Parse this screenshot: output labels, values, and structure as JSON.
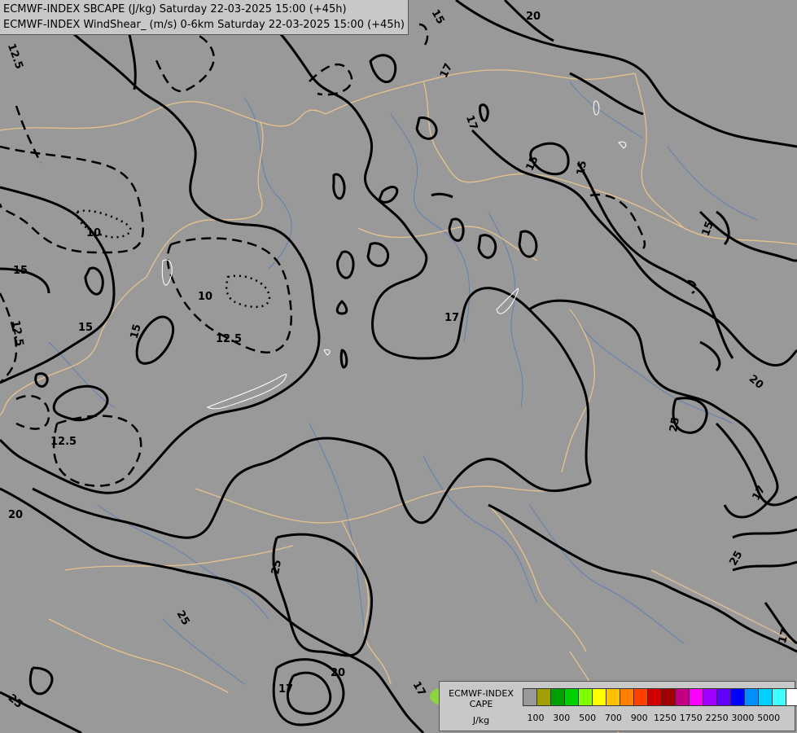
{
  "header": {
    "line1": "ECMWF-INDEX SBCAPE (J/kg) Saturday 22-03-2025 15:00 (+45h)",
    "line2": "ECMWF-INDEX WindShear_ (m/s) 0-6km Saturday 22-03-2025 15:00 (+45h)"
  },
  "contour_labels": [
    "12.5",
    "15",
    "17",
    "20",
    "25",
    "10"
  ],
  "legend": {
    "line1": "ECMWF-INDEX",
    "line2": "CAPE",
    "line3": "J/kg",
    "colors": [
      "#999999",
      "#a0a000",
      "#00a000",
      "#00d000",
      "#80ff00",
      "#ffff00",
      "#ffc000",
      "#ff8000",
      "#ff4000",
      "#d00000",
      "#a00000",
      "#c00080",
      "#ff00ff",
      "#a000ff",
      "#6000ff",
      "#0000ff",
      "#0090ff",
      "#00d0ff",
      "#40ffff",
      "#ffffff"
    ],
    "ticks": [
      "100",
      "300",
      "500",
      "700",
      "900",
      "1250",
      "1750",
      "2250",
      "3000",
      "5000"
    ]
  }
}
